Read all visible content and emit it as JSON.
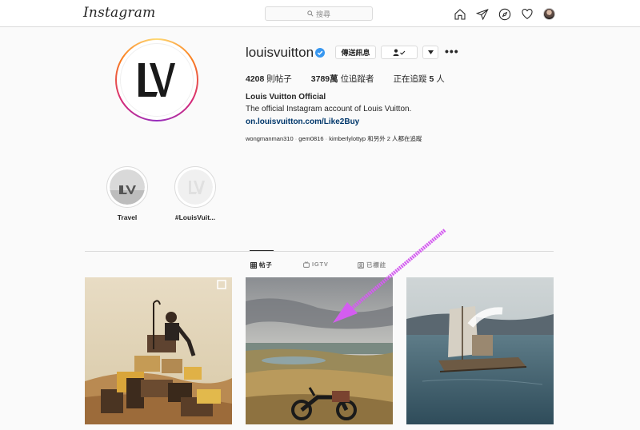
{
  "nav": {
    "logo": "Instagram",
    "search_placeholder": "搜尋",
    "icons": [
      "home-icon",
      "direct-icon",
      "explore-icon",
      "heart-icon",
      "profile-avatar"
    ]
  },
  "profile": {
    "username": "louisvuitton",
    "verified": true,
    "buttons": {
      "message": "傳送訊息",
      "follow_status": "👤✓",
      "dropdown": "▾",
      "more": "•••"
    },
    "stats": {
      "posts_count": "4208",
      "posts_label": "則帖子",
      "followers_count": "3789萬",
      "followers_label": "位追蹤者",
      "following_prefix": "正在追蹤",
      "following_count": "5",
      "following_suffix": "人"
    },
    "full_name": "Louis Vuitton Official",
    "bio": "The official Instagram account of Louis Vuitton.",
    "link": "on.louisvuitton.com/Like2Buy",
    "followed_by": {
      "user1": "wongmanman310",
      "user2": "gem0816",
      "user3": "kimberlylottyp",
      "suffix": "和另外 2 人都在追蹤"
    }
  },
  "highlights": [
    {
      "label": "Travel"
    },
    {
      "label": "#LouisVuit..."
    }
  ],
  "tabs": [
    {
      "label": "帖子",
      "active": true
    },
    {
      "label": "IGTV",
      "active": false
    },
    {
      "label": "已標註",
      "active": false
    }
  ],
  "colors": {
    "accent_link": "#00376b",
    "verified": "#3897f0",
    "annotation_arrow": "#d45df0"
  }
}
